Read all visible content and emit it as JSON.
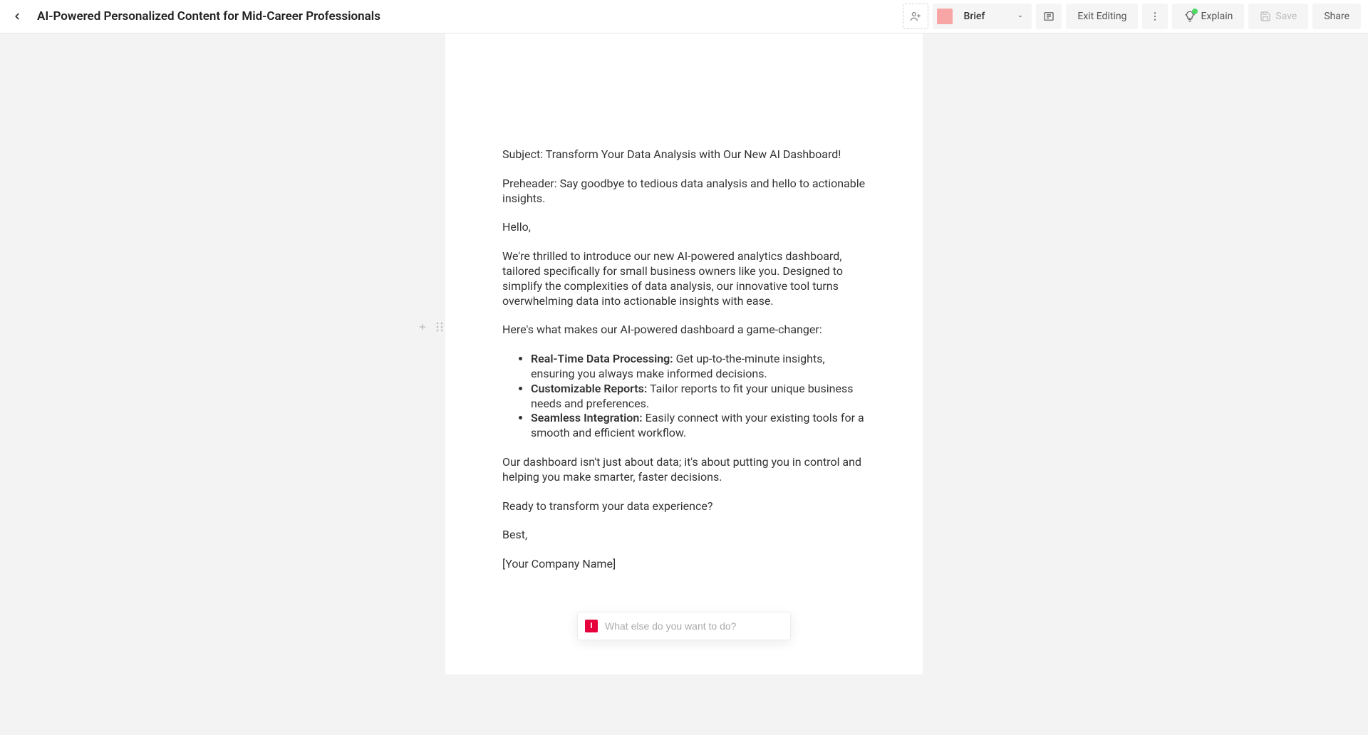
{
  "header": {
    "title": "AI-Powered Personalized Content for Mid-Career Professionals",
    "brief_label": "Brief",
    "exit_label": "Exit Editing",
    "explain_label": "Explain",
    "save_label": "Save",
    "share_label": "Share"
  },
  "document": {
    "subject_prefix": "Subject: ",
    "subject_text": "Transform Your Data Analysis with Our New AI Dashboard!",
    "preheader_prefix": "Preheader: ",
    "preheader_text": "Say goodbye to tedious data analysis and hello to actionable insights.",
    "greeting": "Hello,",
    "intro": "We're thrilled to introduce our new AI-powered analytics dashboard, tailored specifically for small business owners like you. Designed to simplify the complexities of data analysis, our innovative tool turns overwhelming data into actionable insights with ease.",
    "features_lead": "Here's what makes our AI-powered dashboard a game-changer:",
    "features": [
      {
        "title": "Real-Time Data Processing:",
        "desc": " Get up-to-the-minute insights, ensuring you always make informed decisions."
      },
      {
        "title": "Customizable Reports:",
        "desc": " Tailor reports to fit your unique business needs and preferences."
      },
      {
        "title": "Seamless Integration:",
        "desc": " Easily connect with your existing tools for a smooth and efficient workflow."
      }
    ],
    "paragraph2": "Our dashboard isn't just about data; it's about putting you in control and helping you make smarter, faster decisions.",
    "cta_question": "Ready to transform your data experience?",
    "signoff": "Best,",
    "company": "[Your Company Name]"
  },
  "prompt": {
    "placeholder": "What else do you want to do?",
    "badge": "I"
  }
}
